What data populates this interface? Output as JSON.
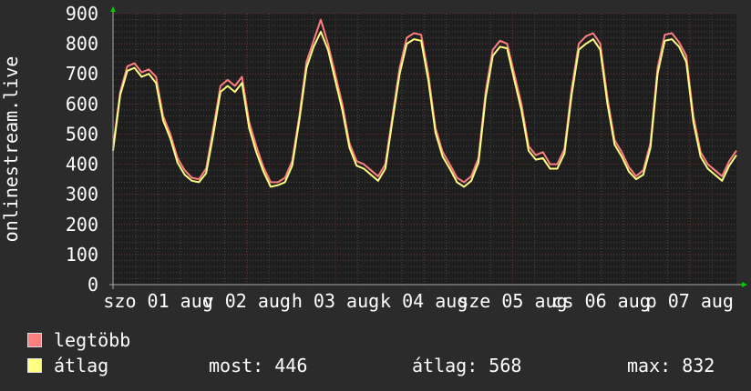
{
  "chart_data": {
    "type": "line",
    "ylabel": "onlinestream.live",
    "ylim": [
      0,
      900
    ],
    "yticks": [
      0,
      100,
      200,
      300,
      400,
      500,
      600,
      700,
      800,
      900
    ],
    "xticks": [
      "szo 01 aug",
      "v 02 aug",
      "h 03 aug",
      "k 04 aug",
      "sze 05 aug",
      "cs 06 aug",
      "p 07 aug"
    ],
    "grid": true,
    "colors": {
      "background": "#2b2b2b",
      "plot": "#1e1e1e",
      "minor_grid": "#474747",
      "day_grid": "#6e2f2f",
      "text": "#ffffff",
      "axis_arrow": "#00cc00"
    },
    "series": [
      {
        "name": "legtöbb",
        "color": "#ff7e7e",
        "values": [
          455,
          640,
          725,
          735,
          705,
          715,
          690,
          560,
          500,
          420,
          380,
          355,
          350,
          385,
          520,
          660,
          680,
          660,
          690,
          540,
          460,
          390,
          340,
          340,
          355,
          410,
          560,
          740,
          810,
          880,
          800,
          700,
          600,
          470,
          410,
          400,
          380,
          360,
          400,
          560,
          720,
          820,
          835,
          830,
          700,
          520,
          440,
          400,
          355,
          340,
          360,
          420,
          640,
          780,
          810,
          800,
          700,
          600,
          460,
          430,
          440,
          400,
          400,
          450,
          650,
          800,
          825,
          835,
          800,
          620,
          480,
          440,
          390,
          360,
          380,
          470,
          720,
          830,
          835,
          805,
          760,
          560,
          440,
          400,
          380,
          360,
          410,
          445
        ]
      },
      {
        "name": "átlag",
        "color": "#ffff80",
        "values": [
          445,
          630,
          710,
          720,
          690,
          700,
          670,
          545,
          485,
          405,
          365,
          345,
          340,
          370,
          500,
          640,
          660,
          640,
          670,
          520,
          440,
          375,
          325,
          330,
          340,
          395,
          545,
          720,
          790,
          840,
          780,
          680,
          580,
          455,
          395,
          385,
          365,
          345,
          385,
          545,
          700,
          800,
          815,
          810,
          680,
          505,
          425,
          385,
          340,
          325,
          345,
          405,
          620,
          760,
          790,
          785,
          680,
          580,
          445,
          415,
          420,
          385,
          385,
          435,
          630,
          780,
          800,
          815,
          780,
          600,
          465,
          425,
          375,
          350,
          365,
          455,
          700,
          810,
          815,
          790,
          740,
          540,
          425,
          385,
          365,
          345,
          395,
          430
        ]
      }
    ]
  },
  "legend": {
    "items": [
      {
        "label": "legtöbb",
        "color": "#ff7e7e"
      },
      {
        "label": "átlag",
        "color": "#ffff80"
      }
    ]
  },
  "stats": {
    "most": "most: 446",
    "atlag": "átlag: 568",
    "max": "max: 832"
  }
}
